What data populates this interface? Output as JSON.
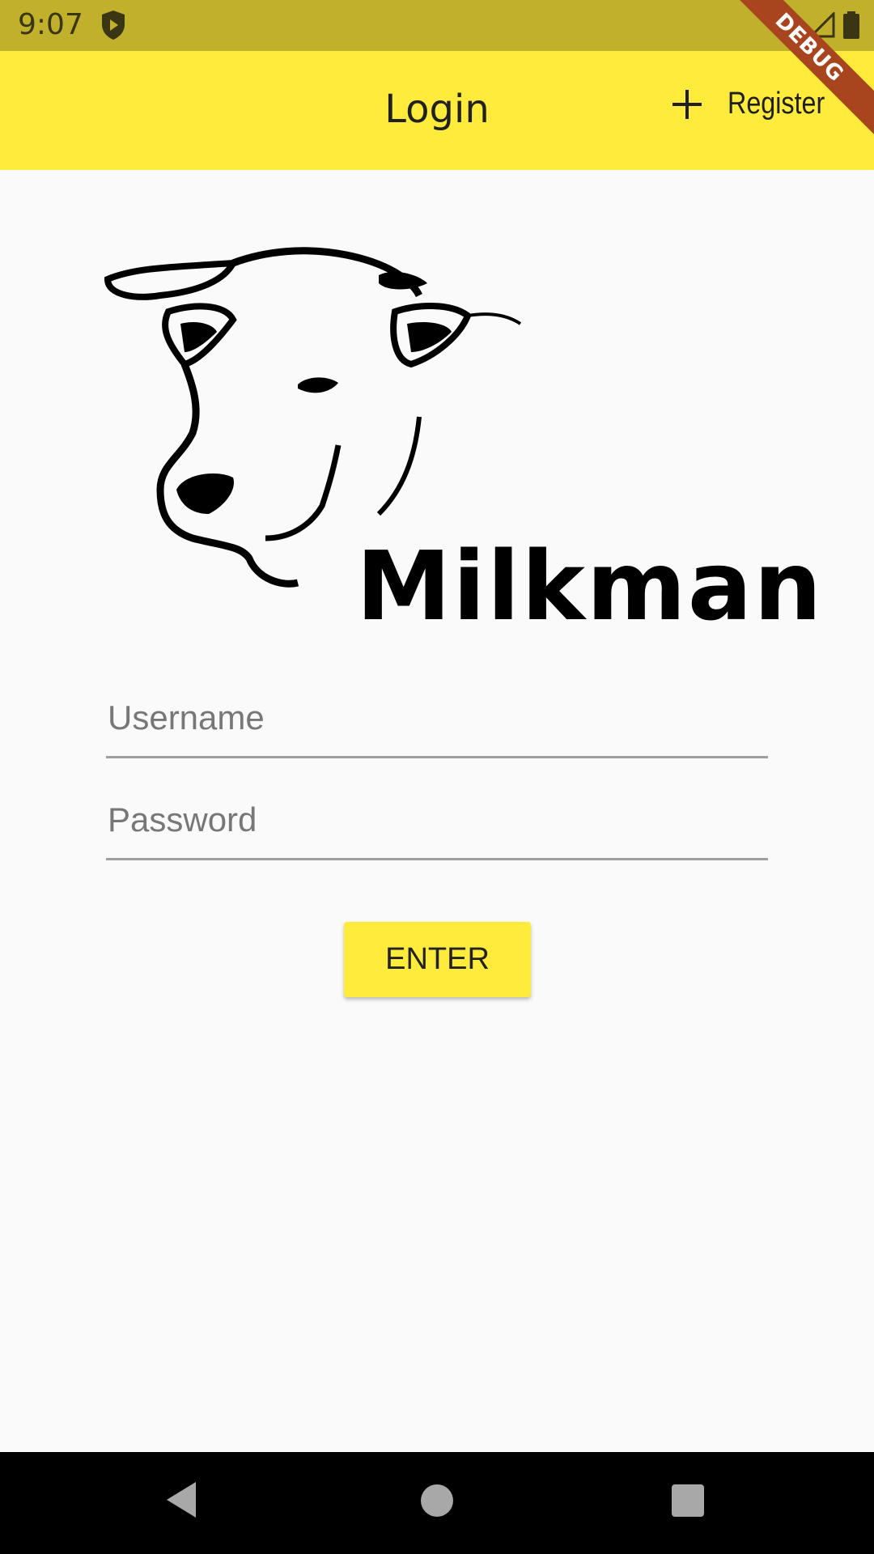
{
  "status_bar": {
    "time": "9:07",
    "debug_label": "DEBUG"
  },
  "app_bar": {
    "title": "Login",
    "register_label": "Register"
  },
  "logo": {
    "text": "Milkman"
  },
  "form": {
    "username_placeholder": "Username",
    "password_placeholder": "Password",
    "enter_label": "ENTER"
  },
  "colors": {
    "accent": "#ffeb3b",
    "status_bar": "#c0b02c",
    "nav_bar": "#000000"
  },
  "icons": [
    "shield-icon",
    "wifi-icon",
    "signal-icon",
    "battery-icon",
    "plus-icon",
    "back-icon",
    "home-icon",
    "recent-apps-icon"
  ]
}
